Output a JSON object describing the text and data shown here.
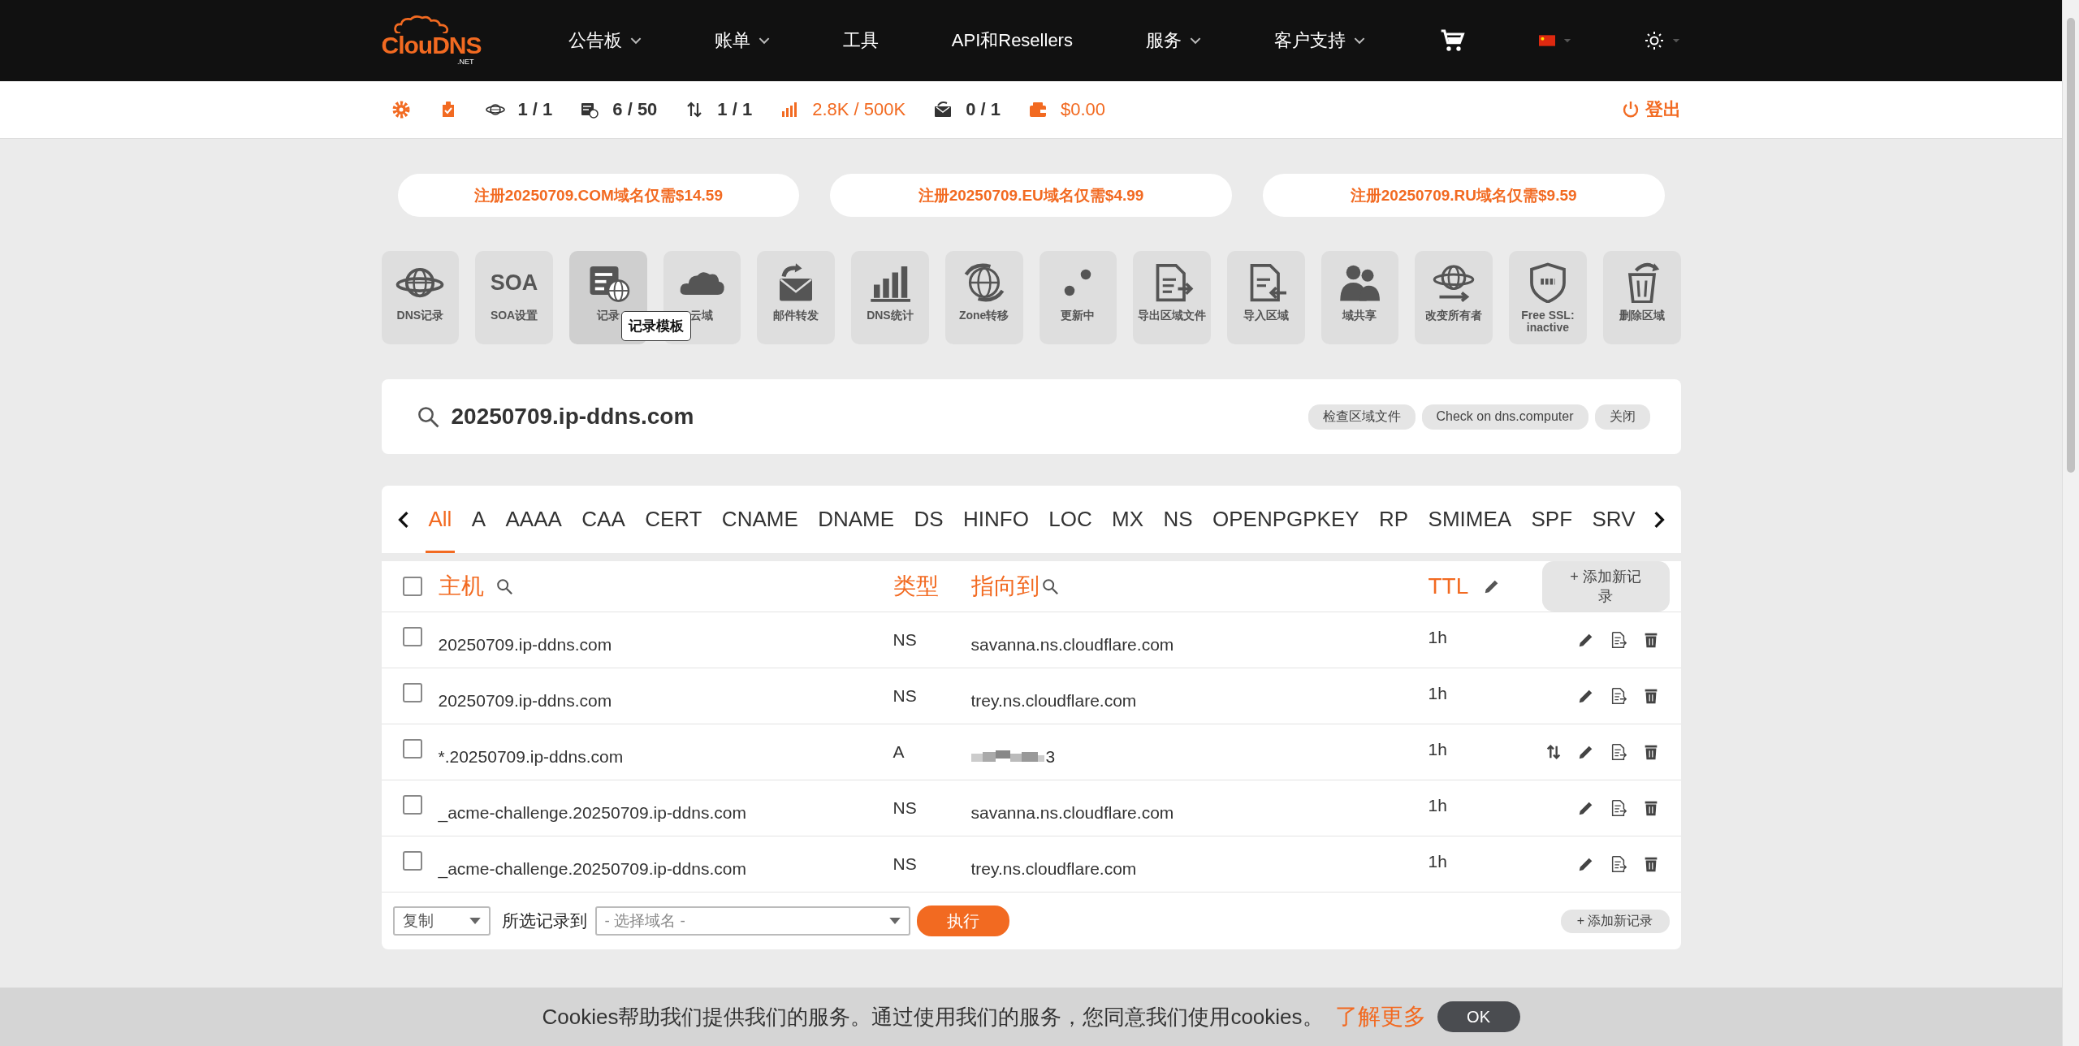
{
  "nav": {
    "logo": {
      "name": "ClouDNS",
      "sub": ".NET"
    },
    "items": [
      {
        "label": "公告板",
        "dropdown": true
      },
      {
        "label": "账单",
        "dropdown": true
      },
      {
        "label": "工具",
        "dropdown": false
      },
      {
        "label": "API和Resellers",
        "dropdown": false
      },
      {
        "label": "服务",
        "dropdown": true
      },
      {
        "label": "客户支持",
        "dropdown": true
      }
    ]
  },
  "stats": [
    {
      "value": "1 / 1",
      "highlight": false
    },
    {
      "value": "6 / 50",
      "highlight": false
    },
    {
      "value": "1 / 1",
      "highlight": false
    },
    {
      "value": "2.8K / 500K",
      "highlight": true
    },
    {
      "value": "0 / 1",
      "highlight": false
    },
    {
      "value": "$0.00",
      "highlight": true
    }
  ],
  "logout": "登出",
  "promos": [
    "注册20250709.COM域名仅需$14.59",
    "注册20250709.EU域名仅需$4.99",
    "注册20250709.RU域名仅需$9.59"
  ],
  "tools": [
    {
      "label": "DNS记录",
      "highlighted": false
    },
    {
      "label": "SOA设置",
      "icon_text": "SOA",
      "highlighted": false
    },
    {
      "label": "记录",
      "highlighted": true
    },
    {
      "label": "云域",
      "highlighted": false
    },
    {
      "label": "邮件转发",
      "highlighted": false
    },
    {
      "label": "DNS统计",
      "highlighted": false
    },
    {
      "label": "Zone转移",
      "highlighted": false
    },
    {
      "label": "更新中",
      "highlighted": false
    },
    {
      "label": "导出区域文件",
      "highlighted": false
    },
    {
      "label": "导入区域",
      "highlighted": false
    },
    {
      "label": "域共享",
      "highlighted": false
    },
    {
      "label": "改变所有者",
      "highlighted": false
    },
    {
      "label": "Free SSL: inactive",
      "highlighted": false
    },
    {
      "label": "删除区域",
      "highlighted": false
    }
  ],
  "tooltip": "记录模板",
  "zone": {
    "name": "20250709.ip-ddns.com",
    "buttons": [
      "检查区域文件",
      "Check on dns.computer",
      "关闭"
    ]
  },
  "tabs": [
    {
      "label": "All",
      "selected": true
    },
    {
      "label": "A",
      "selected": false
    },
    {
      "label": "AAAA",
      "selected": false
    },
    {
      "label": "CAA",
      "selected": false
    },
    {
      "label": "CERT",
      "selected": false
    },
    {
      "label": "CNAME",
      "selected": false
    },
    {
      "label": "DNAME",
      "selected": false
    },
    {
      "label": "DS",
      "selected": false
    },
    {
      "label": "HINFO",
      "selected": false
    },
    {
      "label": "LOC",
      "selected": false
    },
    {
      "label": "MX",
      "selected": false
    },
    {
      "label": "NS",
      "selected": false
    },
    {
      "label": "OPENPGPKEY",
      "selected": false
    },
    {
      "label": "RP",
      "selected": false
    },
    {
      "label": "SMIMEA",
      "selected": false
    },
    {
      "label": "SPF",
      "selected": false
    },
    {
      "label": "SRV",
      "selected": false
    }
  ],
  "table": {
    "columns": {
      "host": "主机",
      "type": "类型",
      "points_to": "指向到",
      "ttl": "TTL"
    },
    "add_button": "+ 添加新记录",
    "select_all_checked": false,
    "rows": [
      {
        "checked": false,
        "host": "20250709.ip-ddns.com",
        "type": "NS",
        "value": "savanna.ns.cloudflare.com",
        "redacted": false,
        "ttl": "1h",
        "failover": false
      },
      {
        "checked": false,
        "host": "20250709.ip-ddns.com",
        "type": "NS",
        "value": "trey.ns.cloudflare.com",
        "redacted": false,
        "ttl": "1h",
        "failover": false
      },
      {
        "checked": false,
        "host": "*.20250709.ip-ddns.com",
        "type": "A",
        "value": "3",
        "redacted": true,
        "ttl": "1h",
        "failover": true
      },
      {
        "checked": false,
        "host": "_acme-challenge.20250709.ip-ddns.com",
        "type": "NS",
        "value": "savanna.ns.cloudflare.com",
        "redacted": false,
        "ttl": "1h",
        "failover": false
      },
      {
        "checked": false,
        "host": "_acme-challenge.20250709.ip-ddns.com",
        "type": "NS",
        "value": "trey.ns.cloudflare.com",
        "redacted": false,
        "ttl": "1h",
        "failover": false
      }
    ]
  },
  "footer": {
    "action": "复制",
    "label": "所选记录到",
    "domain_placeholder": "- 选择域名 -",
    "execute": "执行",
    "add_button": "+ 添加新记录"
  },
  "cookie": {
    "text": "Cookies帮助我们提供我们的服务。通过使用我们的服务，您同意我们使用cookies。",
    "link": "了解更多",
    "ok": "OK"
  }
}
